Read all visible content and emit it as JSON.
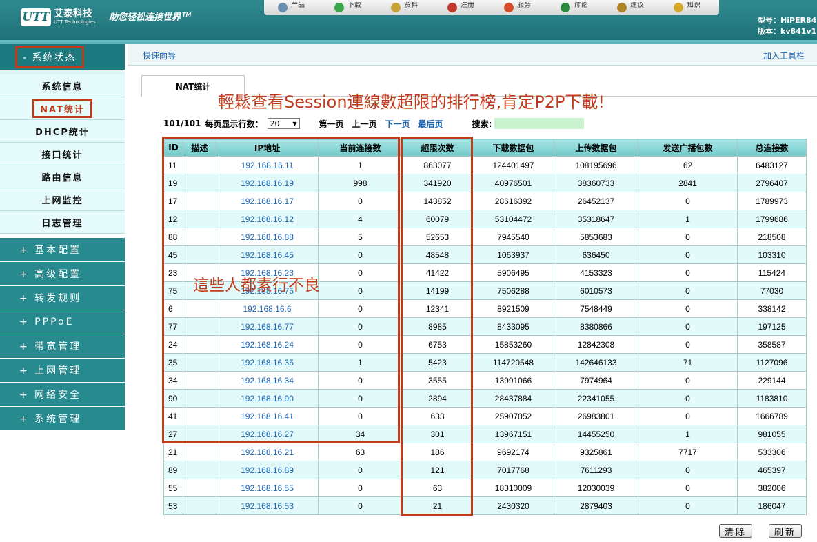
{
  "header": {
    "logo_mark": "UTT",
    "logo_cn": "艾泰科技",
    "logo_en": "UTT Technologies",
    "slogan": "助您轻松连接世界",
    "slogan_tm": "TM",
    "model_line": "型号：HiPER84",
    "version_line": "版本：kv841v1",
    "topbar": [
      {
        "label": "产品",
        "icon": "magnifier-icon",
        "color": "#6b8fb3"
      },
      {
        "label": "下载",
        "icon": "download-arrow-icon",
        "color": "#3aa84a"
      },
      {
        "label": "资料",
        "icon": "document-pen-icon",
        "color": "#c9a33a"
      },
      {
        "label": "注册",
        "icon": "notepad-icon",
        "color": "#c0392b"
      },
      {
        "label": "服务",
        "icon": "phone-icon",
        "color": "#d64d2c"
      },
      {
        "label": "讨论",
        "icon": "users-icon",
        "color": "#2c8a3f"
      },
      {
        "label": "建议",
        "icon": "lightbulb-icon",
        "color": "#b0852a"
      },
      {
        "label": "知识",
        "icon": "book-icon",
        "color": "#d6a92c"
      }
    ]
  },
  "sidebar": {
    "top": "- 系统状态",
    "sub_items": [
      {
        "label": "系统信息",
        "active": false
      },
      {
        "label": "NAT统计",
        "active": true
      },
      {
        "label": "DHCP统计",
        "active": false
      },
      {
        "label": "接口统计",
        "active": false
      },
      {
        "label": "路由信息",
        "active": false
      },
      {
        "label": "上网监控",
        "active": false
      },
      {
        "label": "日志管理",
        "active": false
      }
    ],
    "groups": [
      "+ 基本配置",
      "+ 高级配置",
      "+ 转发规则",
      "+ PPPoE",
      "+ 带宽管理",
      "+ 上网管理",
      "+ 网络安全",
      "+ 系统管理"
    ]
  },
  "navbar": {
    "left": "快速向导",
    "right": "加入工具栏"
  },
  "tab": "NAT统计",
  "annotations": {
    "headline": "輕鬆查看Session連線數超限的排行榜,肯定P2P下載!",
    "bad_users": "這些人都素行不良"
  },
  "controls": {
    "page_count": "101/101",
    "rows_label": "每页显示行数：",
    "rows_value": "20",
    "first": "第一页",
    "prev": "上一页",
    "next": "下一页",
    "last": "最后页",
    "search_label": "搜索:"
  },
  "table": {
    "headers": [
      "ID",
      "描述",
      "IP地址",
      "当前连接数",
      "超限次数",
      "下载数据包",
      "上传数据包",
      "发送广播包数",
      "总连接数"
    ],
    "rows": [
      [
        "11",
        "",
        "192.168.16.11",
        "1",
        "863077",
        "124401497",
        "108195696",
        "62",
        "6483127"
      ],
      [
        "19",
        "",
        "192.168.16.19",
        "998",
        "341920",
        "40976501",
        "38360733",
        "2841",
        "2796407"
      ],
      [
        "17",
        "",
        "192.168.16.17",
        "0",
        "143852",
        "28616392",
        "26452137",
        "0",
        "1789973"
      ],
      [
        "12",
        "",
        "192.168.16.12",
        "4",
        "60079",
        "53104472",
        "35318647",
        "1",
        "1799686"
      ],
      [
        "88",
        "",
        "192.168.16.88",
        "5",
        "52653",
        "7945540",
        "5853683",
        "0",
        "218508"
      ],
      [
        "45",
        "",
        "192.168.16.45",
        "0",
        "48548",
        "1063937",
        "636450",
        "0",
        "103310"
      ],
      [
        "23",
        "",
        "192.168.16.23",
        "0",
        "41422",
        "5906495",
        "4153323",
        "0",
        "115424"
      ],
      [
        "75",
        "",
        "192.168.16.75",
        "0",
        "14199",
        "7506288",
        "6010573",
        "0",
        "77030"
      ],
      [
        "6",
        "",
        "192.168.16.6",
        "0",
        "12341",
        "8921509",
        "7548449",
        "0",
        "338142"
      ],
      [
        "77",
        "",
        "192.168.16.77",
        "0",
        "8985",
        "8433095",
        "8380866",
        "0",
        "197125"
      ],
      [
        "24",
        "",
        "192.168.16.24",
        "0",
        "6753",
        "15853260",
        "12842308",
        "0",
        "358587"
      ],
      [
        "35",
        "",
        "192.168.16.35",
        "1",
        "5423",
        "114720548",
        "142646133",
        "71",
        "1127096"
      ],
      [
        "34",
        "",
        "192.168.16.34",
        "0",
        "3555",
        "13991066",
        "7974964",
        "0",
        "229144"
      ],
      [
        "90",
        "",
        "192.168.16.90",
        "0",
        "2894",
        "28437884",
        "22341055",
        "0",
        "1183810"
      ],
      [
        "41",
        "",
        "192.168.16.41",
        "0",
        "633",
        "25907052",
        "26983801",
        "0",
        "1666789"
      ],
      [
        "27",
        "",
        "192.168.16.27",
        "34",
        "301",
        "13967151",
        "14455250",
        "1",
        "981055"
      ],
      [
        "21",
        "",
        "192.168.16.21",
        "63",
        "186",
        "9692174",
        "9325861",
        "7717",
        "533306"
      ],
      [
        "89",
        "",
        "192.168.16.89",
        "0",
        "121",
        "7017768",
        "7611293",
        "0",
        "465397"
      ],
      [
        "55",
        "",
        "192.168.16.55",
        "0",
        "63",
        "18310009",
        "12030039",
        "0",
        "382006"
      ],
      [
        "53",
        "",
        "192.168.16.53",
        "0",
        "21",
        "2430320",
        "2879403",
        "0",
        "186047"
      ]
    ]
  },
  "buttons": {
    "clear": "清除",
    "refresh": "刷新"
  },
  "colors": {
    "brand_teal": "#1d7a80",
    "annotation_red": "#c0391b",
    "link_blue": "#1a63b4"
  }
}
